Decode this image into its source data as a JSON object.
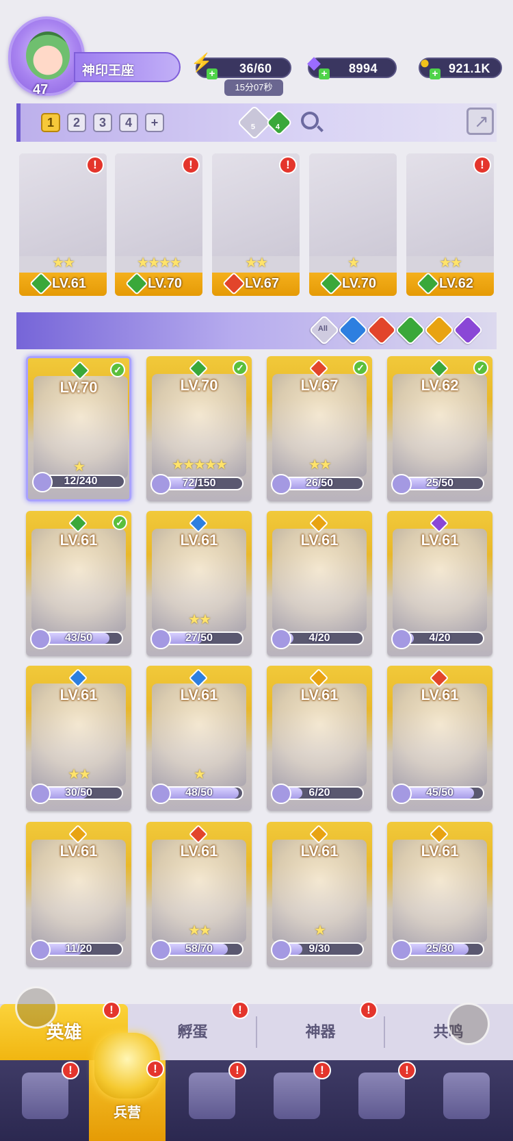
{
  "player": {
    "level": "47",
    "name": "神印王座"
  },
  "resources": {
    "energy": {
      "value": "36/60",
      "timer": "15分07秒",
      "icon": "lightning-icon"
    },
    "gems": {
      "value": "8994",
      "icon": "diamond-icon"
    },
    "gold": {
      "value": "921.1K",
      "icon": "coin-icon"
    }
  },
  "team_tabs": {
    "tabs": [
      "1",
      "2",
      "3",
      "4",
      "+"
    ],
    "active": "1"
  },
  "team_filters": {
    "light_count": "5",
    "nature_count": "4"
  },
  "element_colors": {
    "nature": "#3aa83a",
    "fire": "#e2452b",
    "water": "#2d7fe0",
    "light": "#e8a312",
    "dark": "#8a47d6"
  },
  "team": [
    {
      "level": "LV.61",
      "element": "nature",
      "stars": "★★",
      "alert": "!"
    },
    {
      "level": "LV.70",
      "element": "nature",
      "stars": "★★★★",
      "alert": "!"
    },
    {
      "level": "LV.67",
      "element": "fire",
      "stars": "★★",
      "alert": "!"
    },
    {
      "level": "LV.70",
      "element": "nature",
      "stars": "★",
      "alert": ""
    },
    {
      "level": "LV.62",
      "element": "nature",
      "stars": "★★",
      "alert": "!"
    }
  ],
  "element_filters": [
    "All",
    "water",
    "fire",
    "nature",
    "light",
    "dark"
  ],
  "all_label": "All",
  "heroes": [
    {
      "level": "LV.70",
      "element": "nature",
      "check": true,
      "stars": "★",
      "shards": "12/240",
      "progress": 0.05
    },
    {
      "level": "LV.70",
      "element": "nature",
      "check": true,
      "stars": "★★★★★",
      "shards": "72/150",
      "progress": 0.48
    },
    {
      "level": "LV.67",
      "element": "fire",
      "check": true,
      "stars": "★★",
      "shards": "26/50",
      "progress": 0.52
    },
    {
      "level": "LV.62",
      "element": "nature",
      "check": true,
      "stars": "",
      "shards": "25/50",
      "progress": 0.5
    },
    {
      "level": "LV.61",
      "element": "nature",
      "check": true,
      "stars": "",
      "shards": "43/50",
      "progress": 0.86
    },
    {
      "level": "LV.61",
      "element": "water",
      "check": false,
      "stars": "★★",
      "shards": "27/50",
      "progress": 0.54
    },
    {
      "level": "LV.61",
      "element": "light",
      "check": false,
      "stars": "",
      "shards": "4/20",
      "progress": 0.2
    },
    {
      "level": "LV.61",
      "element": "dark",
      "check": false,
      "stars": "",
      "shards": "4/20",
      "progress": 0.2
    },
    {
      "level": "LV.61",
      "element": "water",
      "check": false,
      "stars": "★★",
      "shards": "30/50",
      "progress": 0.6
    },
    {
      "level": "LV.61",
      "element": "water",
      "check": false,
      "stars": "★",
      "shards": "48/50",
      "progress": 0.96
    },
    {
      "level": "LV.61",
      "element": "light",
      "check": false,
      "stars": "",
      "shards": "6/20",
      "progress": 0.3
    },
    {
      "level": "LV.61",
      "element": "fire",
      "check": false,
      "stars": "",
      "shards": "45/50",
      "progress": 0.9
    },
    {
      "level": "LV.61",
      "element": "light",
      "check": false,
      "stars": "",
      "shards": "11/20",
      "progress": 0.55
    },
    {
      "level": "LV.61",
      "element": "fire",
      "check": false,
      "stars": "★★",
      "shards": "58/70",
      "progress": 0.83
    },
    {
      "level": "LV.61",
      "element": "light",
      "check": false,
      "stars": "★",
      "shards": "9/30",
      "progress": 0.3
    },
    {
      "level": "LV.61",
      "element": "light",
      "check": false,
      "stars": "",
      "shards": "25/30",
      "progress": 0.83
    }
  ],
  "sub_tabs": [
    {
      "label": "英雄",
      "alert": "!"
    },
    {
      "label": "孵蛋",
      "alert": "!"
    },
    {
      "label": "神器",
      "alert": "!"
    },
    {
      "label": "共鸣",
      "alert": ""
    }
  ],
  "nav": [
    {
      "icon": "cards-icon",
      "label": "",
      "alert": "!"
    },
    {
      "icon": "barracks-icon",
      "label": "兵营",
      "alert": "!"
    },
    {
      "icon": "map-icon",
      "label": "",
      "alert": "!"
    },
    {
      "icon": "castle-icon",
      "label": "",
      "alert": "!"
    },
    {
      "icon": "mushroom-icon",
      "label": "",
      "alert": "!"
    },
    {
      "icon": "banner-icon",
      "label": "",
      "alert": ""
    }
  ]
}
